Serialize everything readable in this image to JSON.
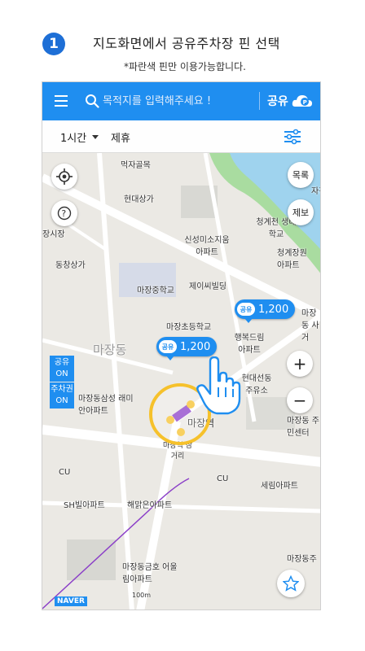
{
  "header": {
    "step_number": "1",
    "title": "지도화면에서 공유주차장 핀 선택",
    "note": "*파란색 핀만 이용가능합니다."
  },
  "appbar": {
    "search_placeholder": "목적지를 입력해주세요 !",
    "share_label": "공유",
    "color": "#1f8ef0"
  },
  "filterbar": {
    "time_label": "1시간",
    "partner_label": "제휴"
  },
  "map_controls": {
    "list_label": "목록",
    "report_label": "제보",
    "zoom_in": "+",
    "zoom_out": "−"
  },
  "pins": [
    {
      "tag": "공유",
      "price": "1,200"
    },
    {
      "tag": "공유",
      "price": "1,200"
    }
  ],
  "legend": [
    {
      "line1": "공유",
      "line2": "ON"
    },
    {
      "line1": "주차권",
      "line2": "ON"
    }
  ],
  "map_labels": {
    "l1": "현대상가",
    "l2": "먹자골목",
    "l3": "동창상가",
    "l4": "청계천 생태학교",
    "l5": "신성미소지움 아파트",
    "l6": "청계장원 아파트",
    "l7": "마장중학교",
    "l8": "제이씨빌딩",
    "l9": "마장초등학교",
    "l10": "행복드림 아파트",
    "l11": "마장동",
    "l12": "마장동삼성 래미안아파트",
    "l13": "마장역",
    "l14": "마장역 삼거리",
    "l15": "마장동 주민센터",
    "l16": "CU",
    "l17": "CU",
    "l18": "세림아파트",
    "l19": "SH빌아파트",
    "l20": "해맑은아파트",
    "l21": "마장동금호 어울림아파트",
    "l22": "마장동주",
    "l23": "장시장",
    "l24": "현대선동 주유소",
    "l25": "마장동 사거",
    "l26": "100m",
    "l27": "자경"
  },
  "naver_logo": "NAVER",
  "accent_colors": {
    "ring": "#f6c12b",
    "subway_line": "#8b3fc8"
  }
}
